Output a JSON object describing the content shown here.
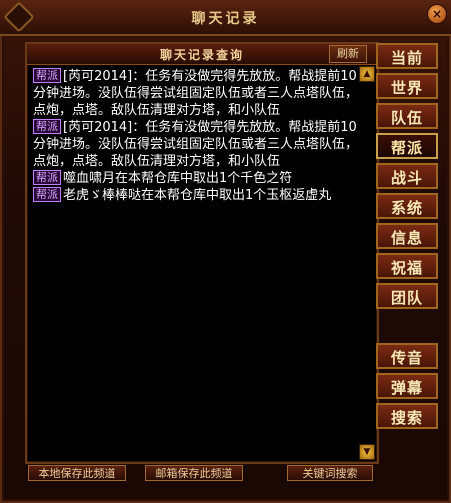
{
  "window": {
    "title": "聊天记录",
    "close_glyph": "×"
  },
  "panel": {
    "title": "聊天记录查询",
    "refresh_label": "刷新"
  },
  "messages": [
    {
      "tag": "帮派",
      "text": "[芮可2014]：任务有没做完得先放放。帮战提前10分钟进场。没队伍得尝试组固定队伍或者三人点塔队伍，点炮，点塔。敌队伍清理对方塔，和小队伍"
    },
    {
      "tag": "帮派",
      "text": "[芮可2014]：任务有没做完得先放放。帮战提前10分钟进场。没队伍得尝试组固定队伍或者三人点塔队伍，点炮，点塔。敌队伍清理对方塔，和小队伍"
    },
    {
      "tag": "帮派",
      "text": "噬血啸月在本帮仓库中取出1个千色之符"
    },
    {
      "tag": "帮派",
      "text": "老虎ゞ棒棒哒在本帮仓库中取出1个玉枢返虚丸"
    }
  ],
  "channels": {
    "current": "当前",
    "world": "世界",
    "team": "队伍",
    "guild": "帮派",
    "battle": "战斗",
    "system": "系统",
    "info": "信息",
    "blessing": "祝福",
    "squad": "团队",
    "broadcast": "传音",
    "danmaku": "弹幕",
    "search": "搜索"
  },
  "bottom": {
    "save_local": "本地保存此频道",
    "save_mail": "邮箱保存此频道",
    "keyword_search": "关键词搜索"
  },
  "colors": {
    "accent": "#a0661e",
    "tag_fg": "#d9a7ff",
    "text": "#ffffff"
  }
}
